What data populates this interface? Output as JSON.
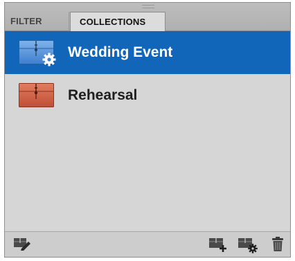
{
  "panel": {
    "tabs": [
      {
        "label": "FILTER",
        "active": false
      },
      {
        "label": "COLLECTIONS",
        "active": true
      }
    ]
  },
  "collections": [
    {
      "name": "Wedding Event",
      "selected": true,
      "icon": "smart-collection-icon",
      "color": "#4a8ad6"
    },
    {
      "name": "Rehearsal",
      "selected": false,
      "icon": "collection-icon",
      "color": "#c8563c"
    }
  ],
  "footer": {
    "icons": [
      "edit-collection-icon",
      "new-collection-icon",
      "new-smart-collection-icon",
      "trash-icon"
    ]
  },
  "colors": {
    "selection": "#1266b9",
    "panel_bg": "#d6d6d6"
  }
}
